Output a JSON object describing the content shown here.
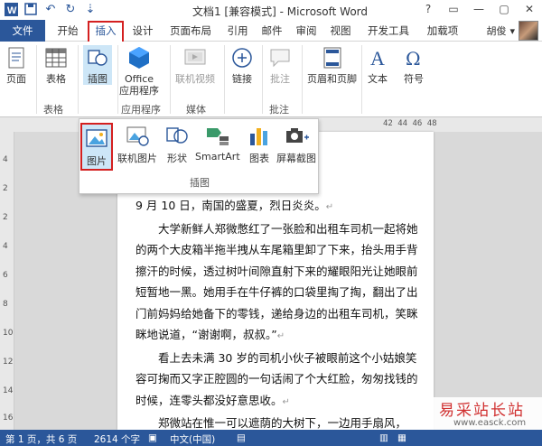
{
  "titlebar": {
    "title": "文档1 [兼容模式] - Microsoft Word",
    "help": "?",
    "minimize": "—",
    "maximize": "▢",
    "close": "✕"
  },
  "ribbon_tabs": [
    "文件",
    "开始",
    "插入",
    "设计",
    "页面布局",
    "引用",
    "邮件",
    "审阅",
    "视图",
    "开发工具",
    "加载项"
  ],
  "active_tab": "插入",
  "user": {
    "name": "胡俊",
    "chevron": "▾"
  },
  "ribbon": {
    "page": "页面",
    "table": "表格",
    "illustrations": "插图",
    "office_apps": "Office\n应用程序",
    "online_video": "联机视频",
    "links": "链接",
    "comment": "批注",
    "header_footer": "页眉和页脚",
    "text": "文本",
    "symbols": "符号",
    "groups": {
      "table": "表格",
      "apps": "应用程序",
      "media": "媒体",
      "comments": "批注"
    }
  },
  "dropdown": {
    "items": [
      "图片",
      "联机图片",
      "形状",
      "SmartArt",
      "图表",
      "屏幕截图"
    ],
    "selected": "图片",
    "group_label": "插图"
  },
  "ruler_text": "42  44  46  48",
  "vruler": [
    "4",
    "2",
    "2",
    "4",
    "6",
    "8",
    "10",
    "12",
    "14",
    "16"
  ],
  "document": {
    "paragraphs": [
      "9 月 10 日，南国的盛夏，烈日炎炎。",
      "　　大学新鲜人郑微憋红了一张脸和出租车司机一起将她的两个大皮箱半拖半拽从车尾箱里卸了下来，抬头用手背擦汗的时候，透过树叶间隙直射下来的耀眼阳光让她眼前短暂地一黑。她用手在牛仔裤的口袋里掏了掏，翻出了出门前妈妈给她备下的零钱，递给身边的出租车司机，笑眯眯地说道，“谢谢啊，叔叔。”",
      "　　看上去未满 30 岁的司机小伙子被眼前这个小姑娘笑容可掬而又字正腔圆的一句话闹了个大红脸，匆匆找钱的时候，连零头都没好意思收。",
      "　　郑微站在惟一可以遮荫的大树下，一边用手扇风，"
    ],
    "para_mark": "↵"
  },
  "status": {
    "page": "第 1 页，共 6 页",
    "words": "2614 个字",
    "language": "中文(中国)"
  },
  "watermark": {
    "line1": "易采站长站",
    "line2": "www.easck.com"
  },
  "colors": {
    "accent": "#2b579a",
    "highlight": "#d42020",
    "selected_bg": "#cde6f7"
  }
}
